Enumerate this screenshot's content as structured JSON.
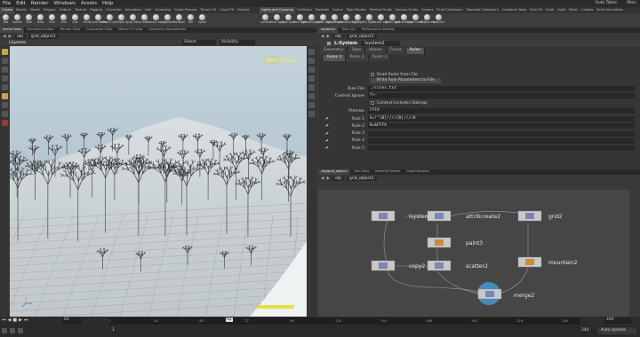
{
  "menubar": {
    "items": [
      "File",
      "Edit",
      "Render",
      "Windows",
      "Assets",
      "Help"
    ],
    "auto_takes": "Auto Takes",
    "desktop": "Main"
  },
  "shelf_left": {
    "tabs": [
      "Create",
      "Modify",
      "Model",
      "Polygon",
      "Deform",
      "Texture",
      "Rigging",
      "Character",
      "Animation",
      "Hair",
      "Grooming",
      "Guide Process",
      "Terrain FX",
      "Cloud FX",
      "Volume"
    ],
    "tools": [
      "Box",
      "Sphere",
      "Tube",
      "Torus",
      "Grid",
      "Null",
      "Line",
      "Circle",
      "Curve Bezier",
      "Draw Curve",
      "Path",
      "Spray Paint",
      "Font",
      "Platonic Solids",
      "L-System",
      "Metaball",
      "File",
      "Spiral"
    ]
  },
  "shelf_right": {
    "tabs": [
      "Lights and Cameras",
      "Collisions",
      "Particles",
      "Grains",
      "Rigid Bodies",
      "Particle Fluids",
      "Viscous Fluids",
      "Oceans",
      "Fluid Containers",
      "Populate Containers",
      "Container Tools",
      "Pyro FX",
      "Cloth",
      "Solid",
      "Wires",
      "Crowds",
      "Drive Simulation"
    ],
    "tools": [
      "Camera",
      "Point Light",
      "Spot Light",
      "Area Light",
      "Geometry Light",
      "Volume Light",
      "Distant Light",
      "Environment Light",
      "Sky Light",
      "GI Light",
      "Caustic Light",
      "Portal Light",
      "Ambient Light",
      "Stereo Camera",
      "VR Camera",
      "Switcher"
    ]
  },
  "left_pane": {
    "tabs": [
      "Scene View",
      "Animation Editor",
      "Render View",
      "Composite View",
      "Motion FX View",
      "Geometry Spreadsheet"
    ],
    "path": [
      "obj",
      "grid_object1"
    ],
    "viewport_title": "LSystem",
    "select_label": "Select",
    "visibility_label": "Visibility",
    "persp_label": "Persp",
    "cam_label": "No cam"
  },
  "right_top": {
    "tabs": [
      "lsystem2",
      "Take List",
      "Performance Monitor"
    ],
    "path": [
      "obj",
      "grid_object1"
    ],
    "node_type": "L-System",
    "node_name": "lsystem2",
    "param_tabs": [
      "Geometry",
      "Tube",
      "Values",
      "Funcs",
      "Rules"
    ],
    "sub_tabs": [
      "Rules 1",
      "Rules 2",
      "Rules 3"
    ],
    "read_rules": "Read Rules from File",
    "write_rules": "Write Rule Parameters to File",
    "rule_file_label": "Rule File",
    "rule_file_value": "./rules.txt",
    "context_ignore_label": "Context Ignore",
    "context_ignore_value": "f+-",
    "context_siblings": "Context Includes Siblings",
    "premise_label": "Premise",
    "premise_value": "FFFA",
    "rules": [
      {
        "label": "Rule 1",
        "value": "A=!\"[B]////[B]////B",
        "checked": true
      },
      {
        "label": "Rule 2",
        "value": "B=&FFFA",
        "checked": true
      },
      {
        "label": "Rule 3",
        "value": "",
        "checked": true
      },
      {
        "label": "Rule 4",
        "value": "",
        "checked": true
      },
      {
        "label": "Rule 5",
        "value": "",
        "checked": true
      }
    ]
  },
  "right_bottom": {
    "tabs": [
      "/obj/grid_object1",
      "Tree View",
      "Material Palette",
      "Asset Browser"
    ],
    "path": [
      "obj",
      "grid_object1"
    ],
    "nodes": [
      "lsystem2",
      "attribcreate2",
      "grid2",
      "paint3",
      "copy2",
      "scatter2",
      "mountain2",
      "merge2"
    ]
  },
  "timeline": {
    "current_frame": "62",
    "marker": "62",
    "start": "1",
    "end": "240",
    "end_field": "240",
    "ticks": [
      "1",
      "24",
      "48",
      "72",
      "96",
      "120",
      "144",
      "168",
      "192",
      "216",
      "240"
    ]
  },
  "status": {
    "auto_update": "Auto Update"
  },
  "colors": {
    "sky": "#b7c8d2",
    "selected_node": "#4aa3df",
    "ui_bg": "#3a3a3a"
  }
}
